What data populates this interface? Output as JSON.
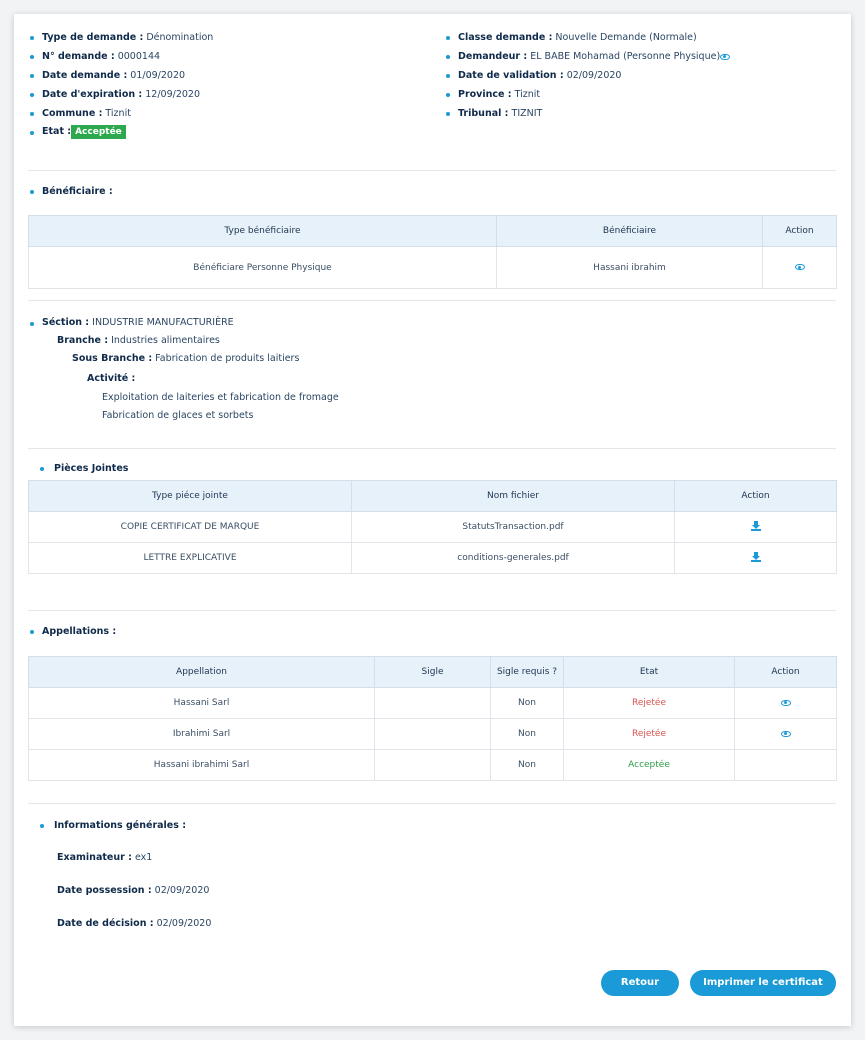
{
  "details": {
    "left": [
      {
        "label": "Type de demande :",
        "value": "Dénomination"
      },
      {
        "label": "N° demande :",
        "value": "0000144"
      },
      {
        "label": "Date demande :",
        "value": "01/09/2020"
      },
      {
        "label": "Date d'expiration :",
        "value": "12/09/2020"
      },
      {
        "label": "Commune :",
        "value": "Tiznit"
      },
      {
        "label": "Etat :",
        "value": "Acceptée"
      }
    ],
    "right": [
      {
        "label": "Classe demande :",
        "value": "Nouvelle Demande (Normale)"
      },
      {
        "label": "Demandeur :",
        "value": "EL BABE Mohamad (Personne Physique)"
      },
      {
        "label": "Date de validation :",
        "value": "02/09/2020"
      },
      {
        "label": "Province :",
        "value": "Tiznit"
      },
      {
        "label": "Tribunal :",
        "value": "TIZNIT"
      }
    ]
  },
  "beneficiaire": {
    "title": "Bénéficiaire :",
    "headers": [
      "Type bénéficiaire",
      "Bénéficiaire",
      "Action"
    ],
    "rows": [
      {
        "type": "Bénéficiare Personne Physique",
        "name": "Hassani ibrahim",
        "action_icon": "eye-icon"
      }
    ]
  },
  "section": {
    "section_label": "Séction :",
    "section_value": "INDUSTRIE MANUFACTURIÈRE",
    "branche_label": "Branche :",
    "branche_value": "Industries alimentaires",
    "sous_branche_label": "Sous Branche :",
    "sous_branche_value": "Fabrication de produits laitiers",
    "activite_label": "Activité :",
    "activites": [
      "Exploitation de laiteries et fabrication de fromage",
      "Fabrication de glaces et sorbets"
    ]
  },
  "pieces": {
    "title": "Pièces Jointes",
    "headers": [
      "Type piéce jointe",
      "Nom fichier",
      "Action"
    ],
    "rows": [
      {
        "type": "COPIE CERTIFICAT DE MARQUE",
        "file": "StatutsTransaction.pdf",
        "action_icon": "download-icon"
      },
      {
        "type": "LETTRE EXPLICATIVE",
        "file": "conditions-generales.pdf",
        "action_icon": "download-icon"
      }
    ]
  },
  "appellations": {
    "title": "Appellations :",
    "headers": [
      "Appellation",
      "Sigle",
      "Sigle requis ?",
      "Etat",
      "Action"
    ],
    "rows": [
      {
        "appellation": "Hassani Sarl",
        "sigle": "",
        "requis": "Non",
        "etat": "Rejetée",
        "etat_color": "#d9534f",
        "has_action": true
      },
      {
        "appellation": "Ibrahimi Sarl",
        "sigle": "",
        "requis": "Non",
        "etat": "Rejetée",
        "etat_color": "#d9534f",
        "has_action": true
      },
      {
        "appellation": "Hassani ibrahimi Sarl",
        "sigle": "",
        "requis": "Non",
        "etat": "Acceptée",
        "etat_color": "#2e9c46",
        "has_action": false
      }
    ]
  },
  "infos": {
    "title": "Informations générales :",
    "examinateur_label": "Examinateur :",
    "examinateur_value": "ex1",
    "possession_label": "Date possession :",
    "possession_value": "02/09/2020",
    "decision_label": "Date de décision :",
    "decision_value": "02/09/2020"
  },
  "buttons": {
    "retour": "Retour",
    "imprimer": "Imprimer le certificat"
  },
  "colors": {
    "accent": "#1a9ad6",
    "accepted": "#2ea84f",
    "rejected": "#d9534f",
    "header_bg": "#e6f1f9"
  }
}
